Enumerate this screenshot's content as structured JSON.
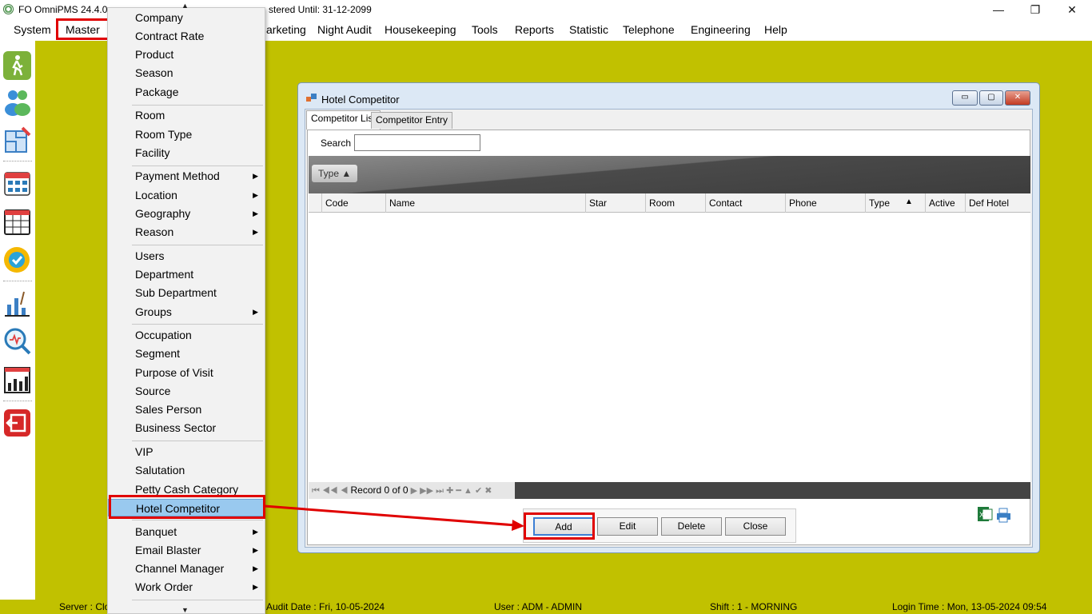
{
  "window": {
    "title_left": "FO OmniPMS 24.4.0.",
    "title_right": "stered Until: 31-12-2099",
    "min": "—",
    "max": "❐",
    "close": "✕"
  },
  "menubar": [
    {
      "label": "System"
    },
    {
      "label": "Master"
    },
    {
      "label": "arketing"
    },
    {
      "label": "Night Audit"
    },
    {
      "label": "Housekeeping"
    },
    {
      "label": "Tools"
    },
    {
      "label": "Reports"
    },
    {
      "label": "Statistic"
    },
    {
      "label": "Telephone"
    },
    {
      "label": "Engineering"
    },
    {
      "label": "Help"
    }
  ],
  "dropdown": {
    "items": [
      {
        "label": "Company"
      },
      {
        "label": "Contract Rate"
      },
      {
        "label": "Product"
      },
      {
        "label": "Season"
      },
      {
        "label": "Package"
      },
      {
        "label": "Room"
      },
      {
        "label": "Room Type"
      },
      {
        "label": "Facility"
      },
      {
        "label": "Payment Method",
        "sub": "▶"
      },
      {
        "label": "Location",
        "sub": "▶"
      },
      {
        "label": "Geography",
        "sub": "▶"
      },
      {
        "label": "Reason",
        "sub": "▶"
      },
      {
        "label": "Users"
      },
      {
        "label": "Department"
      },
      {
        "label": "Sub Department"
      },
      {
        "label": "Groups",
        "sub": "▶"
      },
      {
        "label": "Occupation"
      },
      {
        "label": "Segment"
      },
      {
        "label": "Purpose of Visit"
      },
      {
        "label": "Source"
      },
      {
        "label": "Sales Person"
      },
      {
        "label": "Business Sector"
      },
      {
        "label": "VIP"
      },
      {
        "label": "Salutation"
      },
      {
        "label": "Petty Cash Category"
      },
      {
        "label": "Hotel Competitor"
      },
      {
        "label": "Banquet",
        "sub": "▶"
      },
      {
        "label": "Email Blaster",
        "sub": "▶"
      },
      {
        "label": "Channel Manager",
        "sub": "▶"
      },
      {
        "label": "Work Order",
        "sub": "▶"
      }
    ],
    "scroll_up": "▲",
    "scroll_down": "▼"
  },
  "hotel_competitor": {
    "title": "Hotel Competitor",
    "tabs": [
      {
        "label": "Competitor List"
      },
      {
        "label": "Competitor Entry"
      }
    ],
    "search_label": "Search",
    "search_value": "",
    "group_chip": "Type ▲",
    "columns": [
      {
        "label": "Code"
      },
      {
        "label": "Name"
      },
      {
        "label": "Star"
      },
      {
        "label": "Room"
      },
      {
        "label": "Contact"
      },
      {
        "label": "Phone"
      },
      {
        "label": "Type"
      },
      {
        "label": "Active"
      },
      {
        "label": "Def Hotel"
      }
    ],
    "sort_indicator": "▲",
    "nav_record": "Record 0 of 0",
    "nav_controls": "⏮ ◀◀ ◀",
    "nav_controls_right": "▶ ▶▶ ⏭ ✚ ━ ▲ ✔ ✖",
    "buttons": {
      "add": "Add",
      "edit": "Edit",
      "delete": "Delete",
      "close": "Close"
    },
    "win_min": "▭",
    "win_max": "▢",
    "win_close": "✕"
  },
  "statusbar": {
    "server": "Server : Clo",
    "audit_date": "Audit Date : Fri, 10-05-2024",
    "user": "User : ADM - ADMIN",
    "shift": "Shift : 1 - MORNING",
    "login_time": "Login Time : Mon, 13-05-2024 09:54"
  },
  "colors": {
    "background": "#c1c100",
    "highlight": "#e00000",
    "menu_highlight": "#99c9ef"
  }
}
